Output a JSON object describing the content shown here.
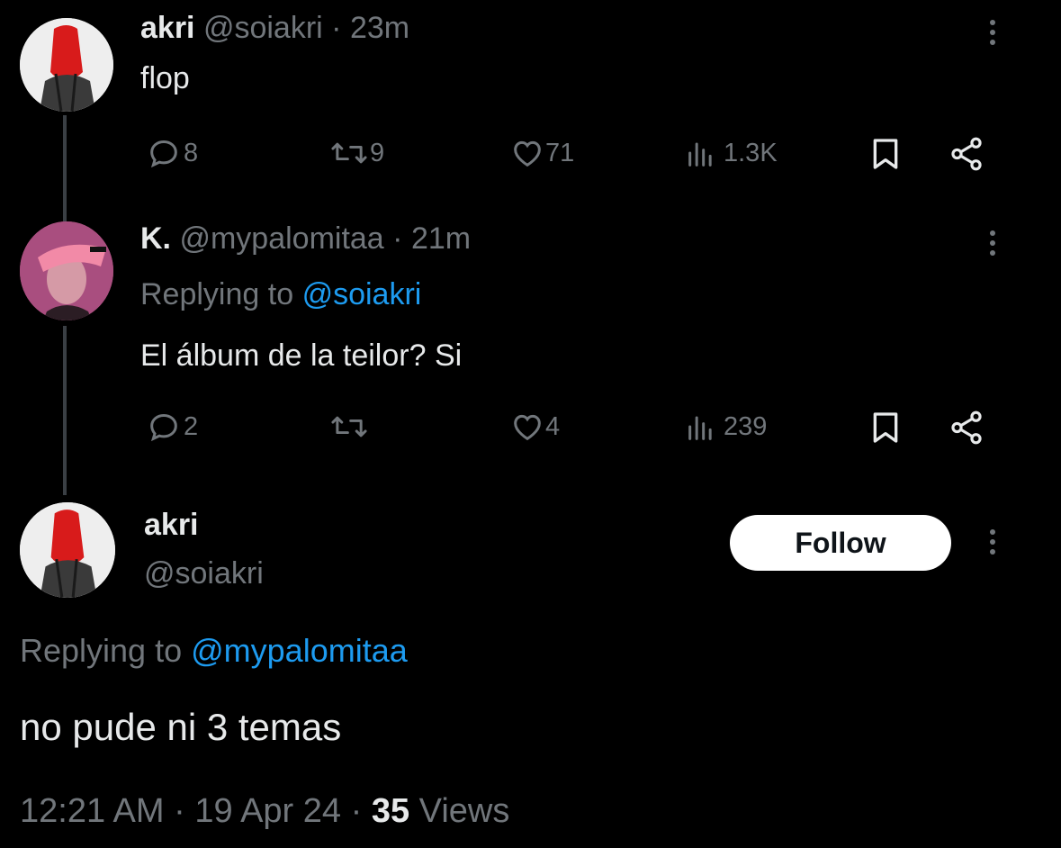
{
  "tweet1": {
    "display_name": "akri",
    "handle": "@soiakri",
    "separator": "·",
    "time": "23m",
    "text": "flop",
    "replies": "8",
    "retweets": "9",
    "likes": "71",
    "views": "1.3K"
  },
  "tweet2": {
    "display_name": "K.",
    "handle": "@mypalomitaa",
    "separator": "·",
    "time": "21m",
    "replying_prefix": "Replying to",
    "replying_handle": "@soiakri",
    "text": "El álbum de la teilor? Si",
    "replies": "2",
    "retweets": "",
    "likes": "4",
    "views": "239"
  },
  "main_tweet": {
    "display_name": "akri",
    "handle": "@soiakri",
    "follow_label": "Follow",
    "replying_prefix": "Replying to",
    "replying_handle": "@mypalomitaa",
    "text": "no pude ni 3 temas",
    "time": "12:21 AM",
    "separator1": "·",
    "date": "19 Apr 24",
    "separator2": "·",
    "views_count": "35",
    "views_label": "Views"
  },
  "colors": {
    "background": "#000000",
    "text": "#e7e9ea",
    "muted": "#71767b",
    "link": "#1d9bf0",
    "follow_bg": "#ffffff"
  },
  "icons": [
    "reply-icon",
    "retweet-icon",
    "like-icon",
    "views-icon",
    "bookmark-icon",
    "share-icon",
    "more-icon"
  ]
}
